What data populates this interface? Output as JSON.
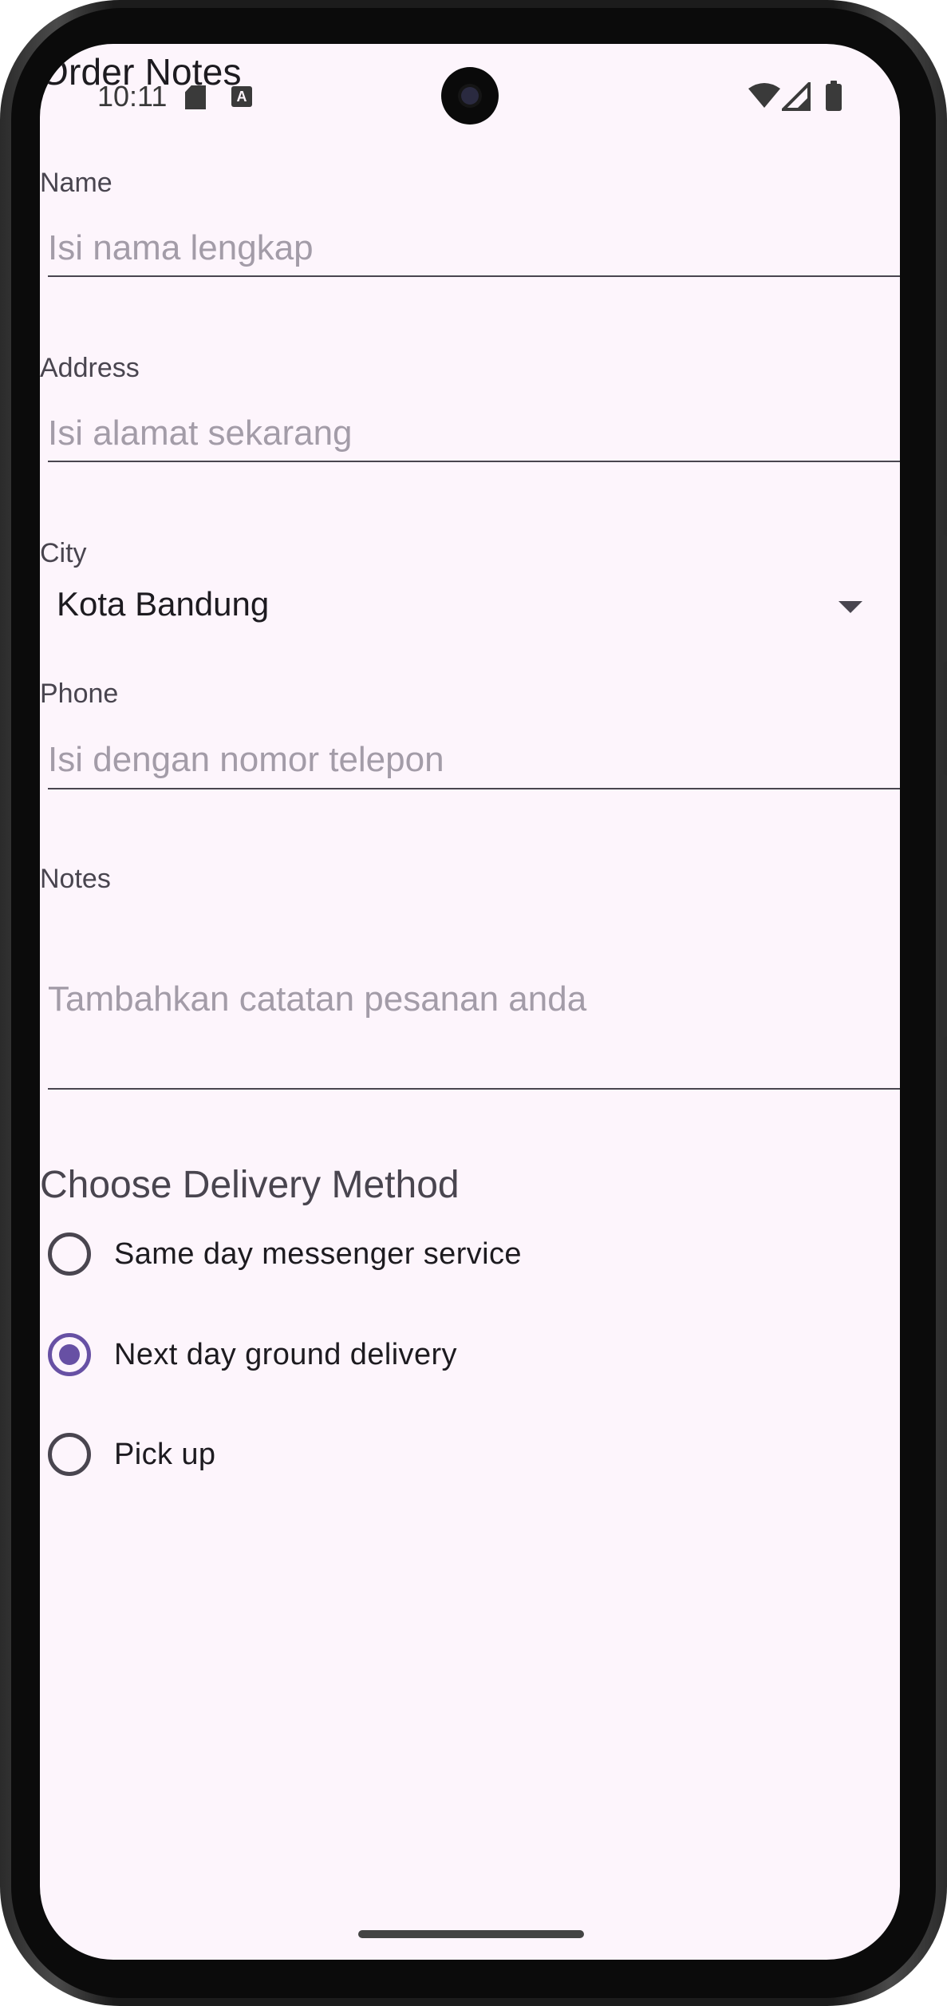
{
  "app": {
    "title": "Order Notes"
  },
  "status_bar": {
    "time": "10:11",
    "icons": [
      "sd-card-icon",
      "a-notification-icon",
      "wifi-icon",
      "cellular-signal-icon",
      "battery-icon"
    ],
    "a_badge": "A"
  },
  "form": {
    "name": {
      "label": "Name",
      "placeholder": "Isi nama lengkap",
      "value": ""
    },
    "address": {
      "label": "Address",
      "placeholder": "Isi alamat sekarang",
      "value": ""
    },
    "city": {
      "label": "City",
      "selected": "Kota Bandung"
    },
    "phone": {
      "label": "Phone",
      "placeholder": "Isi dengan nomor telepon",
      "value": ""
    },
    "notes": {
      "label": "Notes",
      "placeholder": "Tambahkan catatan pesanan anda",
      "value": ""
    }
  },
  "delivery": {
    "heading": "Choose Delivery Method",
    "options": [
      {
        "label": "Same day messenger service",
        "checked": false
      },
      {
        "label": "Next day ground delivery",
        "checked": true
      },
      {
        "label": "Pick up",
        "checked": false
      }
    ]
  },
  "colors": {
    "background": "#fdf5fc",
    "accent": "#6750a4",
    "placeholder": "#a39ca8",
    "label": "#49454f"
  }
}
